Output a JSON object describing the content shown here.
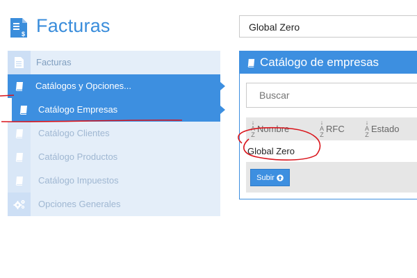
{
  "header": {
    "app_title": "Facturas",
    "logo_icon": "invoice-icon",
    "company_selected": "Global Zero"
  },
  "sidebar": {
    "items": [
      {
        "label": "Facturas",
        "icon": "document-icon"
      },
      {
        "label": "Catálogos y Opciones...",
        "icon": "book-icon"
      },
      {
        "label": "Catálogo Empresas",
        "icon": "book-icon"
      },
      {
        "label": "Catálogo Clientes",
        "icon": "book-icon"
      },
      {
        "label": "Catálogo Productos",
        "icon": "book-icon"
      },
      {
        "label": "Catálogo Impuestos",
        "icon": "book-icon"
      },
      {
        "label": "Opciones Generales",
        "icon": "gears-icon"
      }
    ]
  },
  "panel": {
    "title": "Catálogo de empresas",
    "search_placeholder": "Buscar",
    "columns": [
      "Nombre",
      "RFC",
      "Estado"
    ],
    "rows": [
      {
        "nombre": "Global Zero"
      }
    ],
    "upload_label": "Subir"
  },
  "colors": {
    "accent": "#3d8fe0",
    "title": "#3a8ddb",
    "annotation": "#d9141b"
  }
}
